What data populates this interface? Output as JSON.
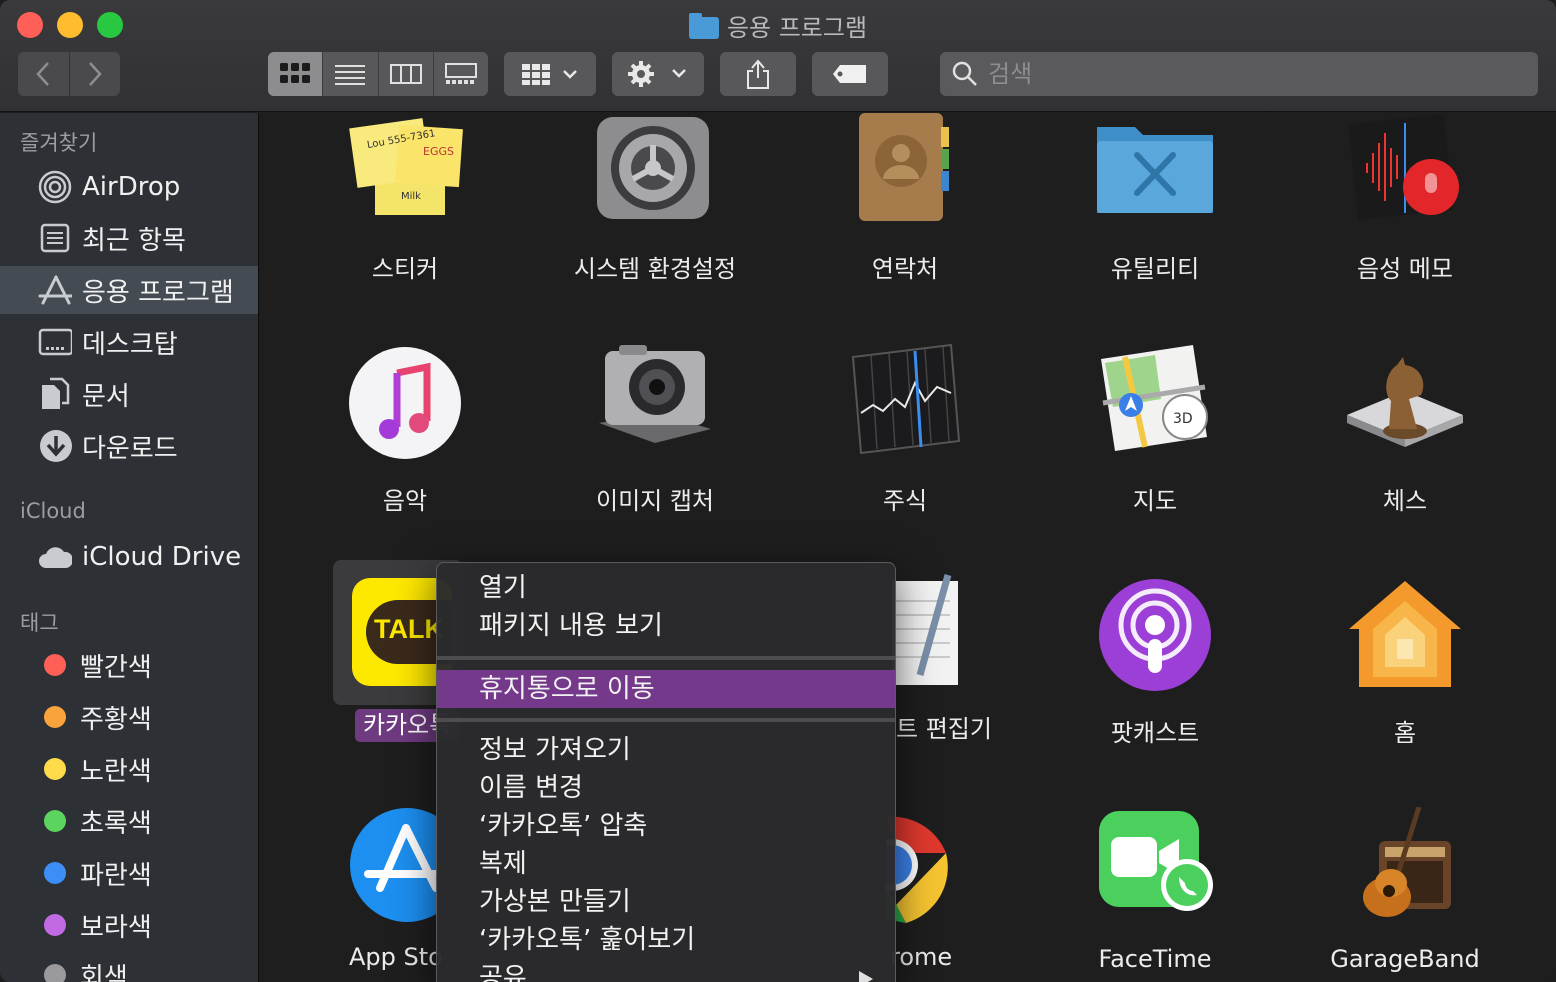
{
  "window": {
    "title": "응용 프로그램"
  },
  "toolbar": {
    "search_placeholder": "검색",
    "icons": [
      "back-icon",
      "forward-icon",
      "icon-view-icon",
      "list-view-icon",
      "column-view-icon",
      "gallery-view-icon",
      "group-icon",
      "gear-icon",
      "share-icon",
      "tag-icon",
      "search-icon"
    ]
  },
  "sidebar": {
    "favorites_header": "즐겨찾기",
    "favorites": [
      {
        "label": "AirDrop",
        "icon": "airdrop-icon"
      },
      {
        "label": "최근 항목",
        "icon": "recents-icon"
      },
      {
        "label": "응용 프로그램",
        "icon": "applications-icon",
        "active": true
      },
      {
        "label": "데스크탑",
        "icon": "desktop-icon"
      },
      {
        "label": "문서",
        "icon": "documents-icon"
      },
      {
        "label": "다운로드",
        "icon": "downloads-icon"
      }
    ],
    "icloud_header": "iCloud",
    "icloud": [
      {
        "label": "iCloud Drive",
        "icon": "cloud-icon"
      }
    ],
    "tags_header": "태그",
    "tags": [
      {
        "label": "빨간색",
        "color": "#fe5f57"
      },
      {
        "label": "주황색",
        "color": "#f8a33c"
      },
      {
        "label": "노란색",
        "color": "#fddb4a"
      },
      {
        "label": "초록색",
        "color": "#5bd55d"
      },
      {
        "label": "파란색",
        "color": "#3e8ef7"
      },
      {
        "label": "보라색",
        "color": "#c16ae3"
      },
      {
        "label": "회색",
        "color": "#9a9a9c"
      }
    ]
  },
  "apps": {
    "row1": [
      "스티커",
      "시스템 환경설정",
      "연락처",
      "유틸리티",
      "음성 메모"
    ],
    "row2": [
      "음악",
      "이미지 캡처",
      "주식",
      "지도",
      "체스"
    ],
    "row3": [
      "카카오톡",
      "텍스트 편집기",
      "팟캐스트",
      "홈"
    ],
    "row4": [
      "App Store",
      "Chrome",
      "FaceTime",
      "GarageBand"
    ]
  },
  "visible_labels": {
    "kakaotalk": "카카오톡",
    "textedit": "트 편집기",
    "appstore": "App Sto",
    "chrome": "rome"
  },
  "icon_text": {
    "stickies_note1": "Lou 555-7361",
    "stickies_note2": "EGGS",
    "stickies_note3": "Milk",
    "kakao_talk": "TALK",
    "maps_3d": "3D"
  },
  "context_menu": {
    "open": "열기",
    "show_package": "패키지 내용 보기",
    "move_to_trash": "휴지통으로 이동",
    "get_info": "정보 가져오기",
    "rename": "이름 변경",
    "compress": "‘카카오톡’ 압축",
    "duplicate": "복제",
    "make_alias": "가상본 만들기",
    "quick_look": "‘카카오톡’ 훑어보기",
    "share": "공유"
  }
}
